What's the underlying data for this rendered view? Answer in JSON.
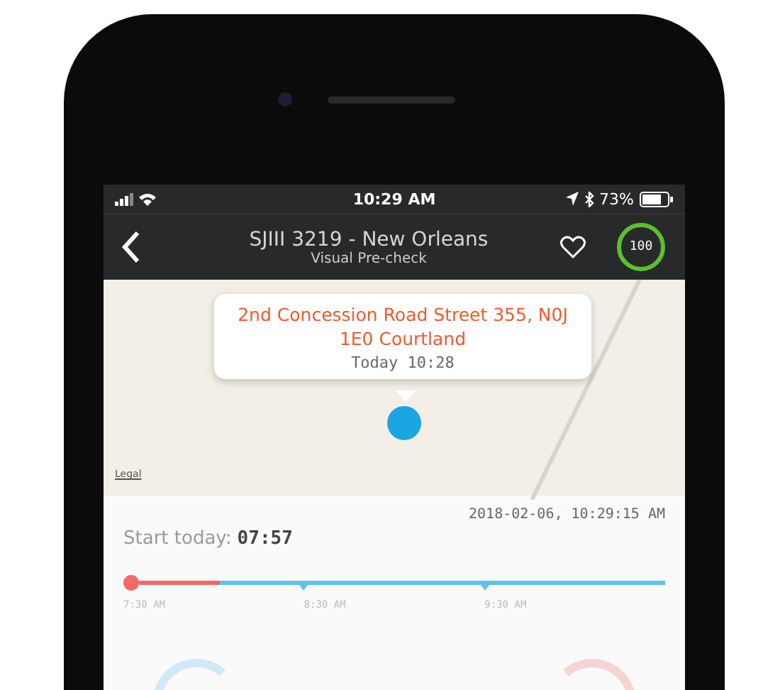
{
  "status_bar": {
    "time": "10:29 AM",
    "battery": "73%"
  },
  "nav": {
    "title": "SJIII 3219 - New Orleans",
    "subtitle": "Visual Pre-check",
    "favorite": false,
    "badge": "100"
  },
  "map": {
    "callout": {
      "address": "2nd Concession Road Street 355, N0J 1E0 Courtland",
      "time": "Today 10:28"
    },
    "legal": "Legal"
  },
  "timestamp": "2018-02-06, 10:29:15 AM",
  "start": {
    "label": "Start today:",
    "time": "07:57"
  },
  "timeline": {
    "level": 0.15,
    "ticks": [
      {
        "label": "7:30 AM"
      },
      {
        "label": "8:30 AM"
      },
      {
        "label": "9:30 AM"
      }
    ]
  }
}
